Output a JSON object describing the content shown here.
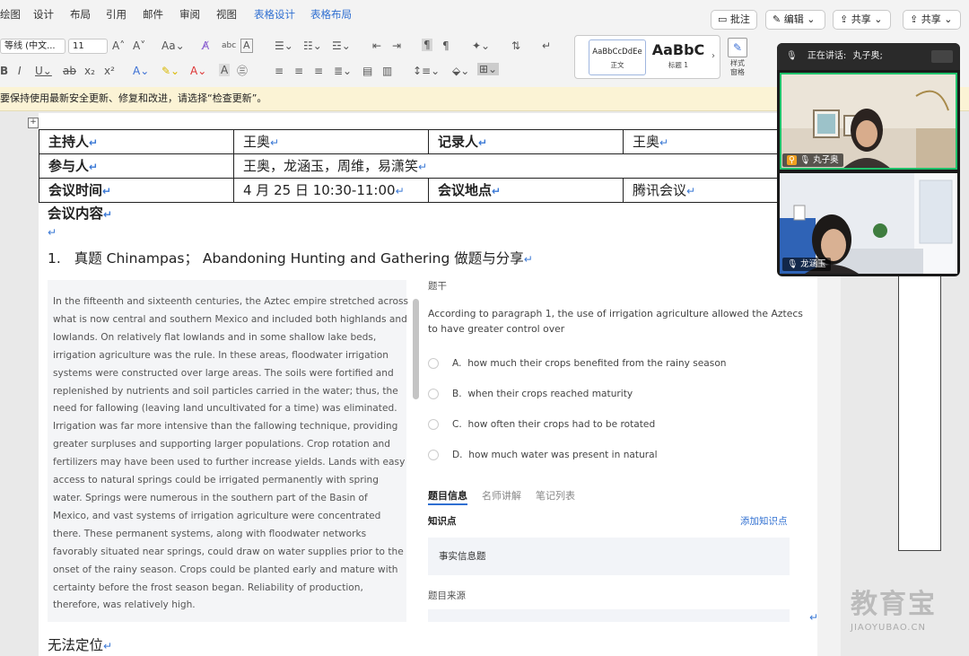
{
  "ribbon": {
    "tabs": [
      {
        "label": "绘图",
        "blue": false
      },
      {
        "label": "设计",
        "blue": false
      },
      {
        "label": "布局",
        "blue": false
      },
      {
        "label": "引用",
        "blue": false
      },
      {
        "label": "邮件",
        "blue": false
      },
      {
        "label": "审阅",
        "blue": false
      },
      {
        "label": "视图",
        "blue": false
      },
      {
        "label": "表格设计",
        "blue": true
      },
      {
        "label": "表格布局",
        "blue": true
      }
    ],
    "comment_label": "批注",
    "edit_label": "编辑",
    "share_label": "共享",
    "share2_label": "共享",
    "font_name": "等线 (中文...",
    "font_size": "11",
    "style_normal_sample": "AaBbCcDdEe",
    "style_normal_name": "正文",
    "style_heading_sample": "AaBbC",
    "style_heading_name": "标题 1",
    "styles_pane_label": "样式窗格"
  },
  "update_bar": {
    "text": "要保持使用最新安全更新、修复和改进，请选择“检查更新”。"
  },
  "meeting_table": {
    "host_label": "主持人",
    "host_value": "王奥",
    "recorder_label": "记录人",
    "recorder_value": "王奥",
    "participants_label": "参与人",
    "participants_value": "王奥，龙涵玉，周维，易潇笑",
    "time_label": "会议时间",
    "time_value": "4 月 25 日  10:30-11:00",
    "place_label": "会议地点",
    "place_value": "腾讯会议"
  },
  "doc": {
    "content_heading": "会议内容",
    "item_number": "1.",
    "item_title": "真题 Chinampas；   Abandoning Hunting and Gathering 做题与分享",
    "footer_heading": "无法定位",
    "return_mark": "↵"
  },
  "practice": {
    "passage_lines": [
      "In the fifteenth and sixteenth centuries, the Aztec empire stretched across",
      "what is now central and southern Mexico and included both highlands and",
      "lowlands. On relatively flat lowlands and in some shallow lake beds,",
      "irrigation agriculture was the rule. In these areas, floodwater irrigation",
      "systems were constructed over large areas. The soils were fortified and",
      "replenished by nutrients and soil particles carried in the water; thus, the",
      "need for fallowing (leaving land uncultivated for a time) was eliminated.",
      "Irrigation was far more intensive than the fallowing technique, providing",
      "greater surpluses and supporting larger populations. Crop rotation and",
      "fertilizers may have been used to further increase yields. Lands with easy",
      "access to natural springs could be irrigated permanently with spring",
      "water. Springs were numerous in the southern part of the Basin of",
      "Mexico, and vast systems of irrigation agriculture were concentrated",
      "there. These permanent systems, along with floodwater networks",
      "favorably situated near springs, could draw on water supplies prior to the",
      "onset of the rainy season. Crops could be planted early and mature with",
      "certainty before the frost season began. Reliability of production,",
      "therefore, was relatively high."
    ],
    "stem_label": "题干",
    "question_line1": "According to paragraph 1, the use of irrigation agriculture allowed the Aztecs",
    "question_line2": "to have greater control over",
    "options": [
      {
        "letter": "A.",
        "text": "how much their crops benefited from the rainy season"
      },
      {
        "letter": "B.",
        "text": "when their crops reached maturity"
      },
      {
        "letter": "C.",
        "text": "how often their crops had to be rotated"
      },
      {
        "letter": "D.",
        "text": "how much water was present in natural"
      }
    ],
    "tabs": [
      "题目信息",
      "名师讲解",
      "笔记列表"
    ],
    "knowledge_label": "知识点",
    "add_knowledge": "添加知识点",
    "knowledge_value": "事实信息题",
    "source_label": "题目来源"
  },
  "meeting": {
    "speaking_prefix": "正在讲话:",
    "speaking_name": "丸子奥;",
    "participant1": "丸子奥",
    "participant2": "龙涵玉"
  },
  "watermark": {
    "brand": "教育宝",
    "url": "JIAOYUBAO.CN"
  },
  "colors": {
    "accent_blue": "#2f6fd1",
    "active_speaker_green": "#1fc16b",
    "update_bar": "#fbf3d5"
  }
}
